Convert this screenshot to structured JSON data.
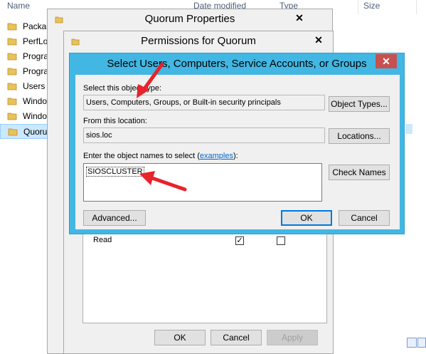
{
  "explorer": {
    "columns": {
      "name": "Name",
      "date_modified": "Date modified",
      "type": "Type",
      "size": "Size"
    },
    "folders": [
      {
        "name": "Packag"
      },
      {
        "name": "PerfLo"
      },
      {
        "name": "Progra"
      },
      {
        "name": "Progra"
      },
      {
        "name": "Users"
      },
      {
        "name": "Windo"
      },
      {
        "name": "Windo"
      },
      {
        "name": "Quoru"
      }
    ]
  },
  "quorum_properties": {
    "title": "Quorum Properties",
    "ok_label": "OK",
    "cancel_label": "Cancel",
    "apply_label": "Apply"
  },
  "permissions": {
    "title": "Permissions for Quorum",
    "row_read": "Read"
  },
  "select_dialog": {
    "title": "Select Users, Computers, Service Accounts, or Groups",
    "object_type_label": "Select this object type:",
    "object_type_value": "Users, Computers, Groups, or Built-in security principals",
    "object_types_button": "Object Types...",
    "location_label": "From this location:",
    "location_value": "sios.loc",
    "locations_button": "Locations...",
    "names_label": "Enter the object names to select (",
    "names_link": "examples",
    "names_label_end": "):",
    "names_value": "SIOSCLUSTER",
    "check_names_button": "Check Names",
    "advanced_button": "Advanced...",
    "ok_button": "OK",
    "cancel_button": "Cancel"
  },
  "colors": {
    "dialog_frame": "#42b7e3",
    "close_button": "#c75050",
    "arrow": "#e8232a",
    "selection": "#cce8ff"
  }
}
